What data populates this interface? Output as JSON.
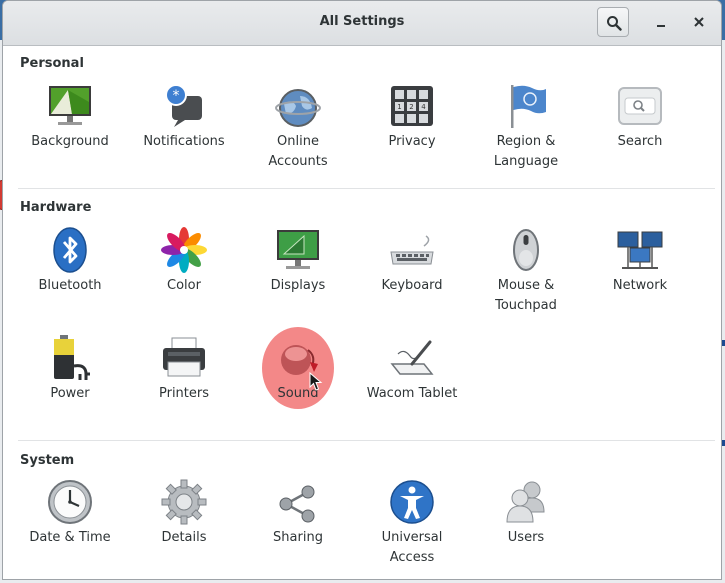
{
  "window": {
    "title": "All Settings",
    "search_icon": "search-icon",
    "minimize_icon": "minimize-icon",
    "close_icon": "close-icon"
  },
  "sections": {
    "personal": {
      "title": "Personal",
      "items": [
        {
          "label": "Background",
          "icon": "background-icon"
        },
        {
          "label": "Notifications",
          "icon": "notifications-icon"
        },
        {
          "label": "Online\nAccounts",
          "icon": "online-accounts-icon"
        },
        {
          "label": "Privacy",
          "icon": "privacy-icon"
        },
        {
          "label": "Region &\nLanguage",
          "icon": "region-language-icon"
        },
        {
          "label": "Search",
          "icon": "search-settings-icon"
        }
      ]
    },
    "hardware": {
      "title": "Hardware",
      "items": [
        {
          "label": "Bluetooth",
          "icon": "bluetooth-icon"
        },
        {
          "label": "Color",
          "icon": "color-icon"
        },
        {
          "label": "Displays",
          "icon": "displays-icon"
        },
        {
          "label": "Keyboard",
          "icon": "keyboard-icon"
        },
        {
          "label": "Mouse &\nTouchpad",
          "icon": "mouse-icon"
        },
        {
          "label": "Network",
          "icon": "network-icon"
        },
        {
          "label": "Power",
          "icon": "power-icon"
        },
        {
          "label": "Printers",
          "icon": "printer-icon"
        },
        {
          "label": "Sound",
          "icon": "sound-icon"
        },
        {
          "label": "Wacom Tablet",
          "icon": "wacom-tablet-icon"
        }
      ]
    },
    "system": {
      "title": "System",
      "items": [
        {
          "label": "Date & Time",
          "icon": "clock-icon"
        },
        {
          "label": "Details",
          "icon": "gear-icon"
        },
        {
          "label": "Sharing",
          "icon": "sharing-icon"
        },
        {
          "label": "Universal\nAccess",
          "icon": "universal-access-icon"
        },
        {
          "label": "Users",
          "icon": "users-icon"
        }
      ]
    }
  },
  "colors": {
    "highlight": "#f06e6e",
    "bluetooth": "#2a6fc4",
    "accent": "#2e3436"
  }
}
